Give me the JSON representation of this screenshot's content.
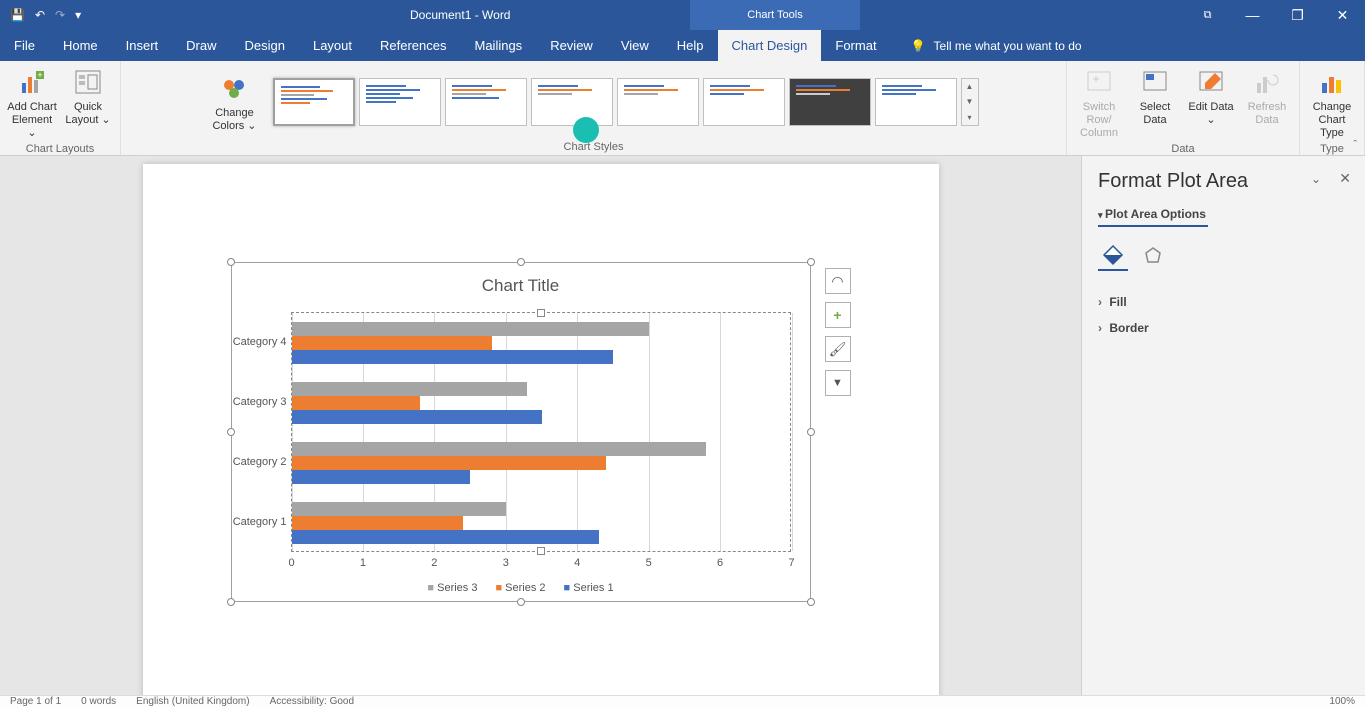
{
  "title": "Document1 - Word",
  "chart_tools_tab": "Chart Tools",
  "qat": {
    "save": "💾",
    "undo": "↶",
    "redo": "↷",
    "più": "▾"
  },
  "window": {
    "min": "—",
    "max": "❐",
    "restore": "⧉",
    "close": "✕"
  },
  "menu": {
    "file": "File",
    "home": "Home",
    "insert": "Insert",
    "draw": "Draw",
    "design": "Design",
    "layout": "Layout",
    "references": "References",
    "mailings": "Mailings",
    "review": "Review",
    "view": "View",
    "help": "Help",
    "chart_design": "Chart Design",
    "format": "Format",
    "tell_me": "Tell me what you want to do"
  },
  "ribbon": {
    "chart_layouts": "Chart Layouts",
    "add_chart_element": "Add Chart Element ⌄",
    "quick_layout": "Quick Layout ⌄",
    "change_colors": "Change Colors ⌄",
    "chart_styles": "Chart Styles",
    "data": "Data",
    "switch_row_col": "Switch Row/ Column",
    "select_data": "Select Data",
    "edit_data": "Edit Data ⌄",
    "refresh_data": "Refresh Data",
    "type": "Type",
    "change_chart_type": "Change Chart Type"
  },
  "chart": {
    "title": "Chart Title",
    "legend": {
      "s3": "Series 3",
      "s2": "Series 2",
      "s1": "Series 1"
    },
    "side_btns": {
      "param": "◠",
      "plus": "+",
      "brush": "🖌",
      "filter": "▼"
    }
  },
  "chart_data": {
    "type": "bar",
    "title": "Chart Title",
    "xlabel": "",
    "ylabel": "",
    "xlim": [
      0,
      7
    ],
    "categories": [
      "Category 1",
      "Category 2",
      "Category 3",
      "Category 4"
    ],
    "series": [
      {
        "name": "Series 3",
        "color": "#a5a5a5",
        "values": [
          3.0,
          5.8,
          3.3,
          5.0
        ]
      },
      {
        "name": "Series 2",
        "color": "#ed7d31",
        "values": [
          2.4,
          4.4,
          1.8,
          2.8
        ]
      },
      {
        "name": "Series 1",
        "color": "#4472c4",
        "values": [
          4.3,
          2.5,
          3.5,
          4.5
        ]
      }
    ],
    "x_ticks": [
      0,
      1,
      2,
      3,
      4,
      5,
      6,
      7
    ]
  },
  "pane": {
    "title": "Format Plot Area",
    "options": "Plot Area Options",
    "fill": "Fill",
    "border": "Border"
  },
  "status": {
    "page": "Page 1 of 1",
    "words": "0 words",
    "lang": "English (United Kingdom)",
    "acc": "Accessibility: Good",
    "zoom": "100%"
  }
}
